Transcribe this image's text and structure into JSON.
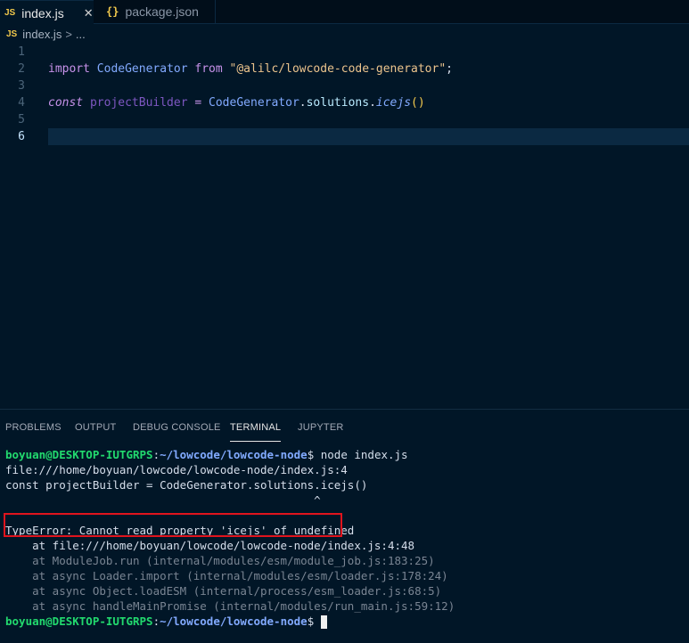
{
  "tabs": [
    {
      "label": "index.js",
      "badge": "JS",
      "close": "✕"
    },
    {
      "label": "package.json",
      "badge": "{}"
    }
  ],
  "breadcrumb": {
    "badge": "JS",
    "file": "index.js",
    "separator": ">",
    "more": "..."
  },
  "editor": {
    "line_numbers": [
      "1",
      "2",
      "3",
      "4",
      "5",
      "6"
    ],
    "line2": {
      "import": "import",
      "name": "CodeGenerator",
      "from": "from",
      "source": "\"@alilc/lowcode-code-generator\"",
      "semi": ";"
    },
    "line4": {
      "const": "const",
      "var": "projectBuilder",
      "eq": "=",
      "obj": "CodeGenerator",
      "dot1": ".",
      "prop": "solutions",
      "dot2": ".",
      "fn": "icejs",
      "parens": "()"
    }
  },
  "panel": {
    "tabs": [
      "PROBLEMS",
      "OUTPUT",
      "DEBUG CONSOLE",
      "TERMINAL",
      "JUPYTER"
    ],
    "active_tab": "TERMINAL"
  },
  "terminal": {
    "user": "boyuan@DESKTOP-IUTGRPS",
    "colon": ":",
    "path": "~/lowcode/lowcode-node",
    "prompt": "$",
    "command": " node index.js",
    "lines": [
      "file:///home/boyuan/lowcode/lowcode-node/index.js:4",
      "const projectBuilder = CodeGenerator.solutions.icejs()",
      "                                              ^",
      "",
      "TypeError: Cannot read property 'icejs' of undefined",
      "    at file:///home/boyuan/lowcode/lowcode-node/index.js:4:48",
      "    at ModuleJob.run (internal/modules/esm/module_job.js:183:25)",
      "    at async Loader.import (internal/modules/esm/loader.js:178:24)",
      "    at async Object.loadESM (internal/process/esm_loader.js:68:5)",
      "    at async handleMainPromise (internal/modules/run_main.js:59:12)"
    ]
  },
  "colors": {
    "background": "#011627",
    "highlight_box": "#e0141d",
    "prompt_user": "#22da6e",
    "prompt_path": "#82aaff"
  }
}
